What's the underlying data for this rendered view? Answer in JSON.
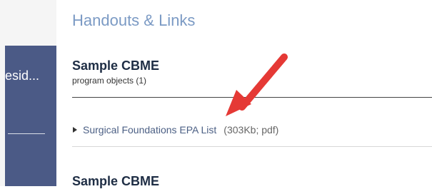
{
  "sidebar": {
    "item_label": "esid..."
  },
  "page": {
    "section_title": "Handouts & Links"
  },
  "content": {
    "block1_title": "Sample CBME",
    "block1_subtitle": "program objects (1)",
    "link_label": "Surgical Foundations EPA List",
    "link_meta": "(303Kb; pdf)",
    "block2_title": "Sample CBME"
  },
  "annotation": {
    "arrow_color": "#e53935"
  },
  "colors": {
    "sidebar_bg": "#4b5a86",
    "section_title": "#7b9ac4",
    "link": "#4b5f84"
  }
}
